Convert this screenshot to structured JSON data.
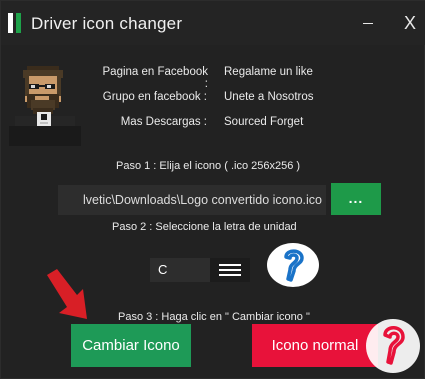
{
  "window": {
    "title": "Driver icon changer",
    "minimize_label": "—",
    "close_label": "X"
  },
  "info": [
    {
      "label": "Pagina en Facebook :",
      "value": "Regalame un like"
    },
    {
      "label": "Grupo en facebook :",
      "value": "Unete a Nosotros"
    },
    {
      "label": "Mas Descargas :",
      "value": "Sourced Forget"
    }
  ],
  "step1": {
    "label": "Paso 1 : Elija el icono ( .ico 256x256 )",
    "path_value": "lvetic\\Downloads\\Logo convertido icono.ico",
    "browse_label": "..."
  },
  "step2": {
    "label": "Paso 2 : Seleccione la letra de unidad",
    "drive_letter": "C"
  },
  "step3": {
    "label": "Paso 3 : Haga clic en \" Cambiar icono \""
  },
  "actions": {
    "change_label": "Cambiar Icono",
    "normal_label": "Icono normal"
  },
  "colors": {
    "accent_green": "#1e9a49",
    "accent_red": "#e8123a",
    "background": "#222222"
  },
  "icons": {
    "app": "app-icon",
    "avatar": "pixel-avatar",
    "arrow": "red-arrow-icon",
    "help": "help-bubble-icon"
  }
}
